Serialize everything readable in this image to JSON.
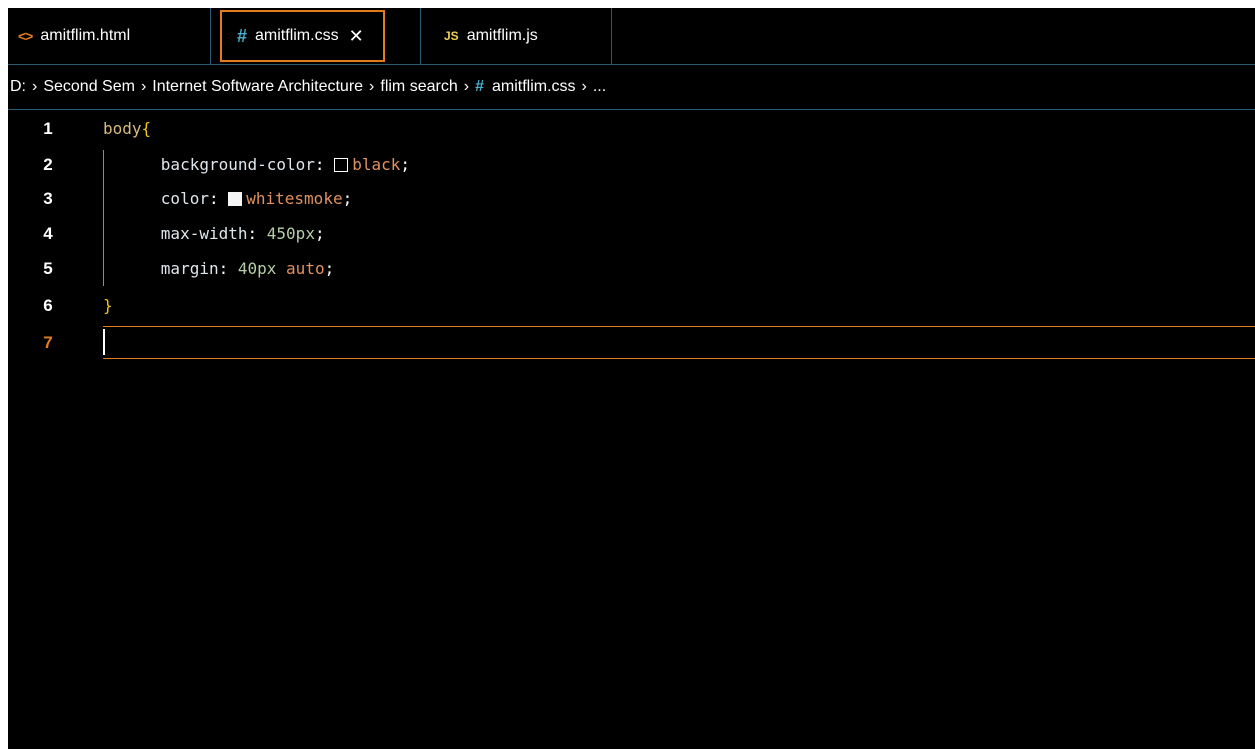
{
  "tabs": [
    {
      "label": "amitflim.html",
      "icon": "html-file-icon",
      "icon_glyph": "<>",
      "active": false
    },
    {
      "label": "amitflim.css",
      "icon": "css-file-icon",
      "icon_glyph": "#",
      "active": true,
      "close_glyph": "✕"
    },
    {
      "label": "amitflim.js",
      "icon": "js-file-icon",
      "icon_glyph": "JS",
      "active": false
    }
  ],
  "breadcrumb": {
    "separator": "›",
    "items": [
      "D:",
      "Second Sem",
      "Internet Software Architecture",
      "flim search"
    ],
    "file_icon_glyph": "#",
    "file": "amitflim.css",
    "ellipsis": "..."
  },
  "code": {
    "active_line": 7,
    "line_numbers": [
      "1",
      "2",
      "3",
      "4",
      "5",
      "6",
      "7"
    ],
    "lines": [
      {
        "selector": "body",
        "brace": "{"
      },
      {
        "property": "background-color",
        "colon": ":",
        "swatch": "#000000",
        "value": "black",
        "semicolon": ";"
      },
      {
        "property": "color",
        "colon": ":",
        "swatch": "#f5f5f5",
        "value": "whitesmoke",
        "semicolon": ";"
      },
      {
        "property": "max-width",
        "colon": ":",
        "number": "450px",
        "semicolon": ";"
      },
      {
        "property": "margin",
        "colon": ":",
        "number": "40px",
        "keyword": "auto",
        "semicolon": ";"
      },
      {
        "brace": "}"
      },
      {
        "text": ""
      }
    ]
  },
  "colors": {
    "background": "#000000",
    "accent": "#e37c1f",
    "css_icon": "#48b0ce",
    "js_icon": "#f0d24c",
    "selector": "#d7ba7d",
    "value_keyword": "#e0915f",
    "number": "#b5cea8"
  }
}
